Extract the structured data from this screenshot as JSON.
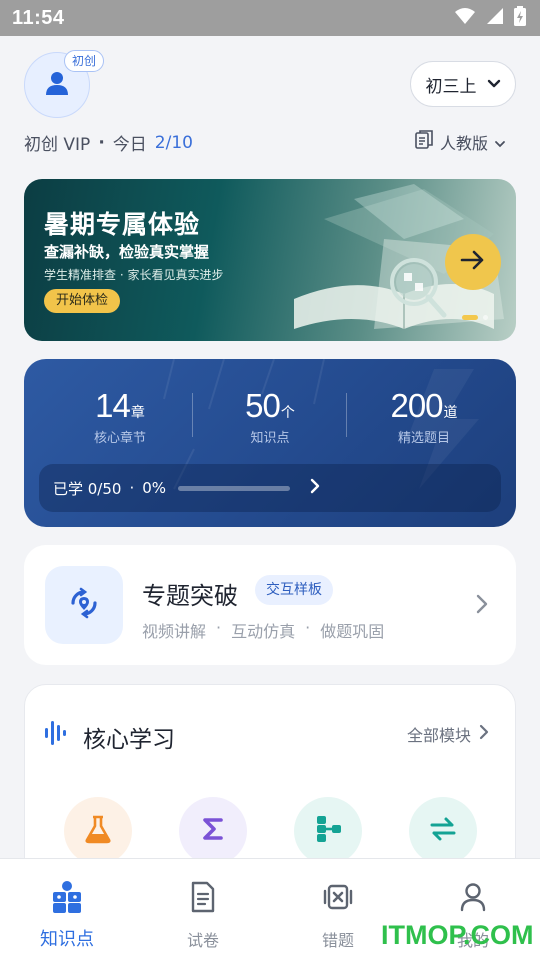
{
  "status_bar": {
    "time": "11:54"
  },
  "header": {
    "avatar_badge": "初创",
    "grade": "初三上",
    "user_level": "初创 VIP",
    "separator": "·",
    "today_label": "今日",
    "today_count": "2/10",
    "edition": "人教版"
  },
  "banner": {
    "title": "暑期专属体验",
    "subtitle": "查漏补缺，检验真实掌握",
    "subtitle2": "学生精准排查 · 家长看见真实进步",
    "button_label": "开始体检",
    "accent_color": "#f0c64c"
  },
  "stats": {
    "items": [
      {
        "value": "14",
        "unit": "章",
        "label": "核心章节"
      },
      {
        "value": "50",
        "unit": "个",
        "label": "知识点"
      },
      {
        "value": "200",
        "unit": "道",
        "label": "精选题目"
      }
    ],
    "progress_text": "已学 0/50",
    "separator": "·",
    "progress_percent": "0%",
    "progress_fraction": 0
  },
  "topic": {
    "title": "专题突破",
    "tag": "交互样板",
    "features": [
      "视频讲解",
      "·",
      "互动仿真",
      "·",
      "做题巩固"
    ]
  },
  "core": {
    "title": "核心学习",
    "all_modules": "全部模块",
    "modules": [
      {
        "icon": "flask-icon",
        "color": "#f08a24"
      },
      {
        "icon": "sigma-icon",
        "color": "#7b52d6"
      },
      {
        "icon": "flowchart-icon",
        "color": "#14a394"
      },
      {
        "icon": "swap-icon",
        "color": "#14a394"
      }
    ]
  },
  "nav": {
    "items": [
      {
        "label": "知识点",
        "active": true
      },
      {
        "label": "试卷",
        "active": false
      },
      {
        "label": "错题",
        "active": false
      },
      {
        "label": "我的",
        "active": false
      }
    ]
  },
  "watermark": "ITMOP.COM"
}
